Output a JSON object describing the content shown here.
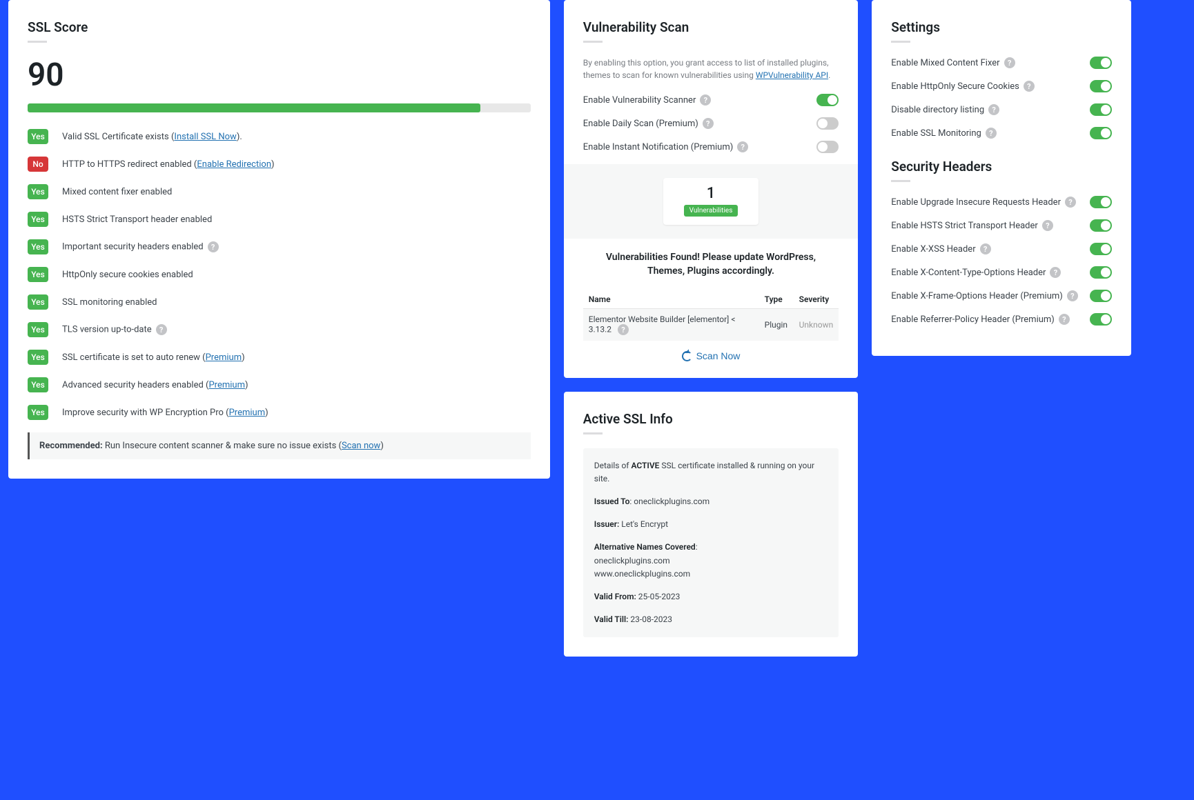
{
  "ssl_score": {
    "title": "SSL Score",
    "value": "90",
    "bar_pct": 90,
    "checks": [
      {
        "status": "Yes",
        "text": "Valid SSL Certificate exists (",
        "link": "Install SSL Now",
        "suffix": ").",
        "help": false
      },
      {
        "status": "No",
        "text": "HTTP to HTTPS redirect enabled (",
        "link": "Enable Redirection",
        "suffix": ")",
        "help": false
      },
      {
        "status": "Yes",
        "text": "Mixed content fixer enabled",
        "link": "",
        "suffix": "",
        "help": false
      },
      {
        "status": "Yes",
        "text": "HSTS Strict Transport header enabled",
        "link": "",
        "suffix": "",
        "help": false
      },
      {
        "status": "Yes",
        "text": "Important security headers enabled",
        "link": "",
        "suffix": "",
        "help": true
      },
      {
        "status": "Yes",
        "text": "HttpOnly secure cookies enabled",
        "link": "",
        "suffix": "",
        "help": false
      },
      {
        "status": "Yes",
        "text": "SSL monitoring enabled",
        "link": "",
        "suffix": "",
        "help": false
      },
      {
        "status": "Yes",
        "text": "TLS version up-to-date",
        "link": "",
        "suffix": "",
        "help": true
      },
      {
        "status": "Yes",
        "text": "SSL certificate is set to auto renew (",
        "link": "Premium",
        "suffix": ")",
        "help": false
      },
      {
        "status": "Yes",
        "text": "Advanced security headers enabled (",
        "link": "Premium",
        "suffix": ")",
        "help": false
      },
      {
        "status": "Yes",
        "text": "Improve security with WP Encryption Pro (",
        "link": "Premium",
        "suffix": ")",
        "help": false
      }
    ],
    "recommended_label": "Recommended:",
    "recommended_text": " Run Insecure content scanner & make sure no issue exists (",
    "recommended_link": "Scan now",
    "recommended_suffix": ")"
  },
  "vuln_scan": {
    "title": "Vulnerability Scan",
    "desc_pre": "By enabling this option, you grant access to list of installed plugins, themes to scan for known vulnerabilities using ",
    "desc_link": "WPVulnerability API",
    "desc_suffix": ".",
    "toggles": [
      {
        "label": "Enable Vulnerability Scanner",
        "on": true
      },
      {
        "label": "Enable Daily Scan (Premium)",
        "on": false
      },
      {
        "label": "Enable Instant Notification (Premium)",
        "on": false
      }
    ],
    "count": "1",
    "count_label": "Vulnerabilities",
    "found_heading": "Vulnerabilities Found! Please update WordPress, Themes, Plugins accordingly.",
    "table": {
      "headers": [
        "Name",
        "Type",
        "Severity"
      ],
      "rows": [
        {
          "name": "Elementor Website Builder [elementor] < 3.13.2",
          "type": "Plugin",
          "severity": "Unknown"
        }
      ]
    },
    "scan_btn": "Scan Now"
  },
  "active_ssl": {
    "title": "Active SSL Info",
    "intro_pre": "Details of ",
    "intro_strong": "ACTIVE",
    "intro_post": " SSL certificate installed & running on your site.",
    "issued_to_label": "Issued To",
    "issued_to": "oneclickplugins.com",
    "issuer_label": "Issuer:",
    "issuer": "Let's Encrypt",
    "alt_label": "Alternative Names Covered",
    "alt_names": "oneclickplugins.com\nwww.oneclickplugins.com",
    "valid_from_label": "Valid From:",
    "valid_from": "25-05-2023",
    "valid_till_label": "Valid Till:",
    "valid_till": "23-08-2023"
  },
  "settings": {
    "title": "Settings",
    "toggles": [
      {
        "label": "Enable Mixed Content Fixer",
        "on": true
      },
      {
        "label": "Enable HttpOnly Secure Cookies",
        "on": true
      },
      {
        "label": "Disable directory listing",
        "on": true
      },
      {
        "label": "Enable SSL Monitoring",
        "on": true
      }
    ]
  },
  "security_headers": {
    "title": "Security Headers",
    "toggles": [
      {
        "label": "Enable Upgrade Insecure Requests Header",
        "on": true
      },
      {
        "label": "Enable HSTS Strict Transport Header",
        "on": true
      },
      {
        "label": "Enable X-XSS Header",
        "on": true
      },
      {
        "label": "Enable X-Content-Type-Options Header",
        "on": true
      },
      {
        "label": "Enable X-Frame-Options Header (Premium)",
        "on": true
      },
      {
        "label": "Enable Referrer-Policy Header (Premium)",
        "on": true
      }
    ]
  }
}
